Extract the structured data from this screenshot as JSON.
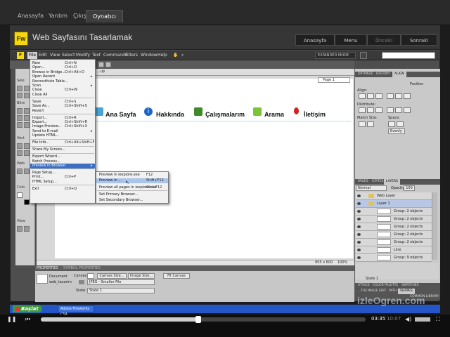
{
  "player_tabs": [
    "Anasayfa",
    "Yardım",
    "Çıkış",
    "Oynatıcı"
  ],
  "lesson": {
    "logo": "Fw",
    "title": "Web Sayfasını Tasarlamak",
    "nav": [
      "Anasayfa",
      "Menu",
      "Önceki",
      "Sonraki"
    ]
  },
  "menubar": [
    "File",
    "Edit",
    "View",
    "Select",
    "Modify",
    "Text",
    "Commands",
    "Filters",
    "Window",
    "Help"
  ],
  "expanded_mode": "EXPANDED MODE",
  "document": {
    "tab": "...up",
    "page": "Page 1",
    "nav_items": [
      "Ana Sayfa",
      "Hakkında",
      "Çalışmalarım",
      "Arama",
      "İletişim"
    ],
    "size": "955 x 600",
    "zoom": "100%"
  },
  "file_menu": [
    {
      "label": "New",
      "shortcut": "Ctrl+N"
    },
    {
      "label": "Open...",
      "shortcut": "Ctrl+O"
    },
    {
      "label": "Browse in Bridge...",
      "shortcut": "Ctrl+Alt+O"
    },
    {
      "label": "Open Recent",
      "shortcut": ""
    },
    {
      "label": "Reconstitute Table...",
      "shortcut": ""
    },
    {
      "label": "Scan",
      "shortcut": ""
    },
    {
      "label": "Close",
      "shortcut": "Ctrl+W"
    },
    {
      "label": "Close All",
      "shortcut": ""
    },
    {
      "label": "Save",
      "shortcut": "Ctrl+S"
    },
    {
      "label": "Save As...",
      "shortcut": "Ctrl+Shift+S"
    },
    {
      "label": "Revert",
      "shortcut": ""
    },
    {
      "label": "Import...",
      "shortcut": "Ctrl+R"
    },
    {
      "label": "Export...",
      "shortcut": "Ctrl+Shift+R"
    },
    {
      "label": "Image Preview...",
      "shortcut": "Ctrl+Shift+X"
    },
    {
      "label": "Send to E-mail",
      "shortcut": ""
    },
    {
      "label": "Update HTML...",
      "shortcut": ""
    },
    {
      "label": "File Info...",
      "shortcut": "Ctrl+Alt+Shift+F"
    },
    {
      "label": "Share My Screen...",
      "shortcut": ""
    },
    {
      "label": "Export Wizard...",
      "shortcut": ""
    },
    {
      "label": "Batch Process...",
      "shortcut": ""
    },
    {
      "label": "Preview in Browser",
      "shortcut": ""
    },
    {
      "label": "Page Setup...",
      "shortcut": ""
    },
    {
      "label": "Print...",
      "shortcut": "Ctrl+P"
    },
    {
      "label": "HTML Setup...",
      "shortcut": ""
    },
    {
      "label": "Exit",
      "shortcut": "Ctrl+Q"
    }
  ],
  "preview_submenu": [
    {
      "label": "Preview in iexplore.exe",
      "shortcut": "F12"
    },
    {
      "label": "Preview in ...",
      "shortcut": "Shift+F12"
    },
    {
      "label": "Preview all pages in iexplore.exe",
      "shortcut": "Ctrl+F12"
    },
    {
      "label": "Set Primary Browser...",
      "shortcut": ""
    },
    {
      "label": "Set Secondary Browser...",
      "shortcut": ""
    }
  ],
  "properties": {
    "tabs": [
      "PROPERTIES",
      "SYMBOL PROPERTIES"
    ],
    "doc_label": "Document",
    "doc_name": "web_tasarim",
    "canvas_label": "Canvas:",
    "canvas_size_btn": "Canvas Size...",
    "image_size_btn": "Image Size...",
    "fit_canvas_btn": "Fit Canvas",
    "format": "JPEG - Smaller File",
    "state_label": "State:",
    "state_value": "State 1"
  },
  "right_panel": {
    "top_tabs": [
      "OPTIMIZE",
      "HISTORY",
      "ALIGN"
    ],
    "position": "Position",
    "align": "Align:",
    "distribute": "Distribute:",
    "match_size": "Match Size:",
    "space": "Space:",
    "evenly": "Evenly",
    "layer_tabs": [
      "PAGES",
      "STATES",
      "LAYERS"
    ],
    "blend": "Normal",
    "opacity_label": "Opacity",
    "opacity_value": "100",
    "layers": [
      {
        "name": "Web Layer",
        "type": "layer"
      },
      {
        "name": "Layer 1",
        "type": "layer"
      },
      {
        "name": "Group: 2 objects",
        "type": "obj"
      },
      {
        "name": "Group: 2 objects",
        "type": "obj"
      },
      {
        "name": "Group: 2 objects",
        "type": "obj"
      },
      {
        "name": "Group: 2 objects",
        "type": "obj"
      },
      {
        "name": "Group: 2 objects",
        "type": "obj"
      },
      {
        "name": "Line",
        "type": "obj"
      },
      {
        "name": "Group: 9 objects",
        "type": "obj"
      }
    ],
    "state_footer": "State 1",
    "bottom_tabs": [
      "STYLES",
      "COLOR PALETTE",
      "SWATCHES"
    ],
    "bottom_tabs2": [
      "...THE",
      "IMAGE EDIT",
      "PATH",
      "SHAPES"
    ],
    "bottom_tabs3": [
      "COMMON LIBRARY"
    ]
  },
  "taskbar": {
    "start": "Başlat",
    "item": "Adobe Fireworks CS4..."
  },
  "watermark": "izleOgren.com",
  "player": {
    "current": "03:35",
    "total": "10:07",
    "progress": 0.485
  }
}
